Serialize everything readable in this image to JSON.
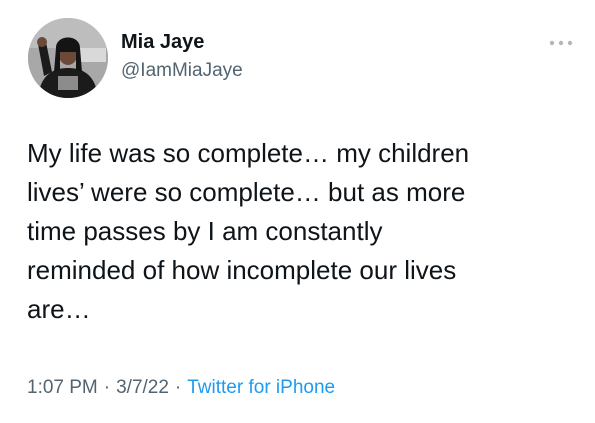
{
  "author": {
    "display_name": "Mia Jaye",
    "handle": "@IamMiaJaye",
    "avatar_icon": "profile-photo"
  },
  "tweet": {
    "text": "My life was so complete… my children\nlives’ were so complete… but as more\ntime passes by I am constantly\nreminded of how incomplete our lives\nare…",
    "time": "1:07 PM",
    "separator": "·",
    "date": "3/7/22",
    "source": "Twitter for iPhone"
  },
  "colors": {
    "text": "#0f1419",
    "secondary": "#536471",
    "link": "#1d9bf0",
    "more_icon": "#b0b7bd"
  },
  "icons": {
    "more": "more-horizontal-icon"
  }
}
